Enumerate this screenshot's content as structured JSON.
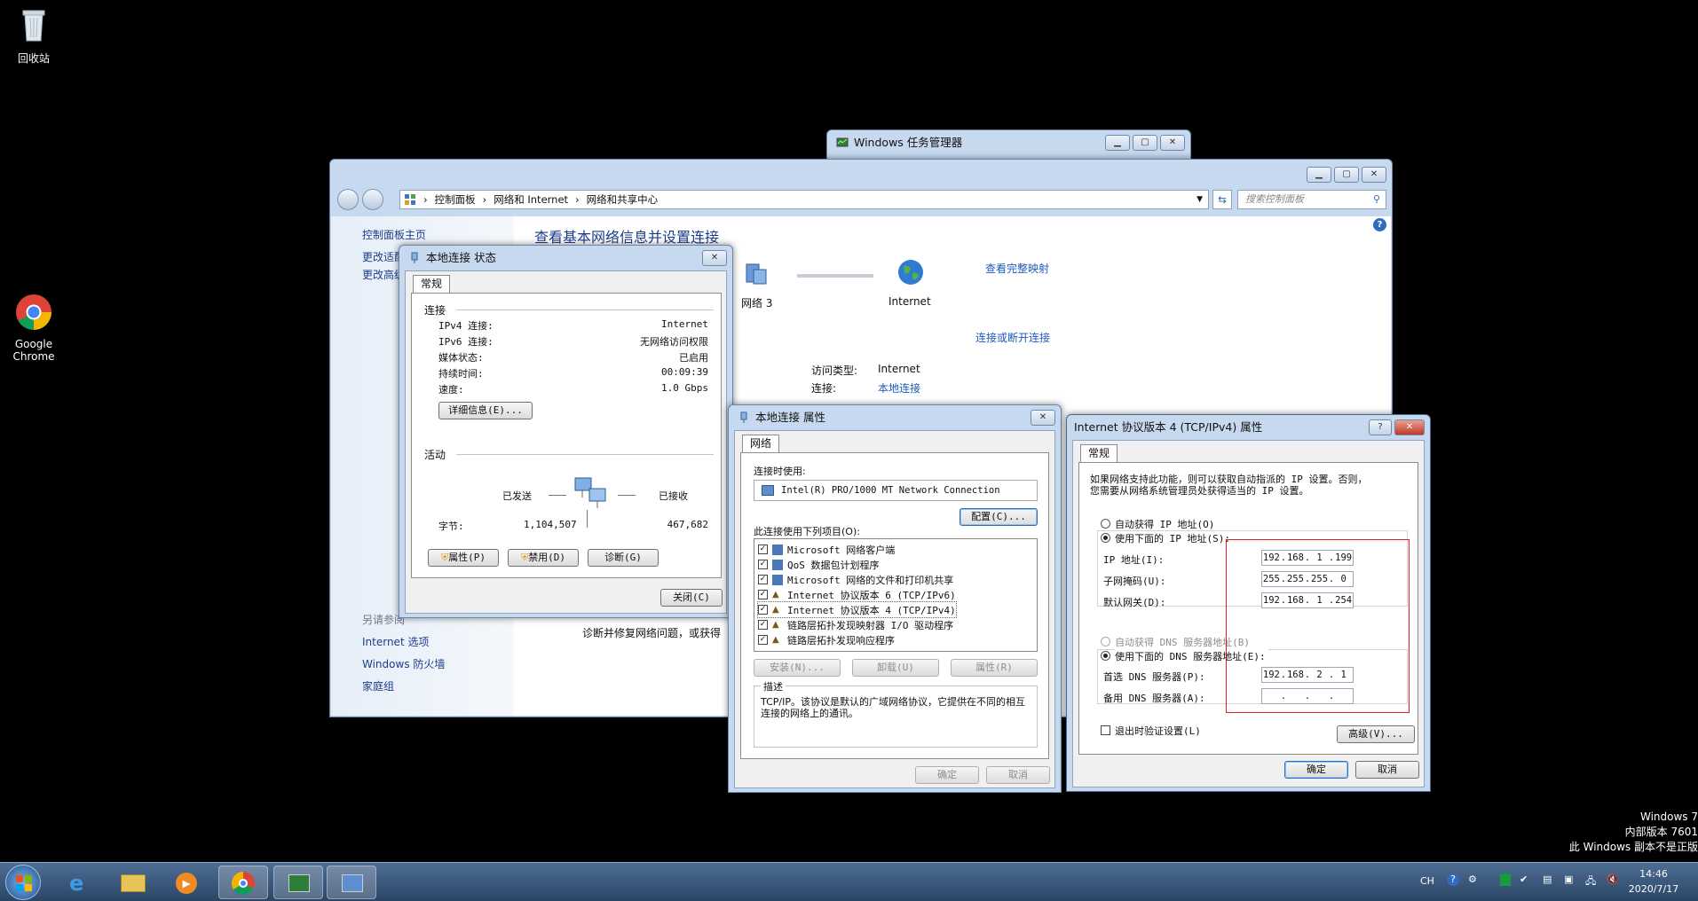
{
  "desktop": {
    "recycle_bin": "回收站",
    "chrome_line1": "Google",
    "chrome_line2": "Chrome",
    "watermark": [
      "Windows 7",
      "内部版本 7601",
      "此 Windows 副本不是正版"
    ]
  },
  "task_manager": {
    "title": "Windows 任务管理器"
  },
  "control_panel": {
    "breadcrumb": [
      "控制面板",
      "网络和 Internet",
      "网络和共享中心"
    ],
    "search_placeholder": "搜索控制面板",
    "sidebar": {
      "home": "控制面板主页",
      "item1": "更改适配",
      "item2": "更改高级",
      "see_also": "另请参阅",
      "links": [
        "Internet 选项",
        "Windows 防火墙",
        "家庭组"
      ]
    },
    "heading": "查看基本网络信息并设置连接",
    "network_name": "网络 3",
    "internet_label": "Internet",
    "view_full_map": "查看完整映射",
    "connect_disconnect": "连接或断开连接",
    "access_type_label": "访问类型:",
    "access_type_value": "Internet",
    "connection_label": "连接:",
    "connection_value": "本地连接",
    "troubleshoot": "诊断并修复网络问题，或获得"
  },
  "status_dialog": {
    "title": "本地连接 状态",
    "tab": "常规",
    "section_connection": "连接",
    "rows": [
      {
        "label": "IPv4 连接:",
        "value": "Internet"
      },
      {
        "label": "IPv6 连接:",
        "value": "无网络访问权限"
      },
      {
        "label": "媒体状态:",
        "value": "已启用"
      },
      {
        "label": "持续时间:",
        "value": "00:09:39"
      },
      {
        "label": "速度:",
        "value": "1.0 Gbps"
      }
    ],
    "details_button": "详细信息(E)...",
    "section_activity": "活动",
    "sent_label": "已发送",
    "received_label": "已接收",
    "bytes_label": "字节:",
    "bytes_sent": "1,104,507",
    "bytes_received": "467,682",
    "properties_button": "属性(P)",
    "disable_button": "禁用(D)",
    "diagnose_button": "诊断(G)",
    "close_button": "关闭(C)"
  },
  "props_dialog": {
    "title": "本地连接 属性",
    "tab": "网络",
    "connect_using_label": "连接时使用:",
    "adapter": "Intel(R) PRO/1000 MT Network Connection",
    "configure_button": "配置(C)...",
    "items_label": "此连接使用下列项目(O):",
    "items": [
      "Microsoft 网络客户端",
      "QoS 数据包计划程序",
      "Microsoft 网络的文件和打印机共享",
      "Internet 协议版本 6 (TCP/IPv6)",
      "Internet 协议版本 4 (TCP/IPv4)",
      "链路层拓扑发现映射器 I/O 驱动程序",
      "链路层拓扑发现响应程序"
    ],
    "install_button": "安装(N)...",
    "uninstall_button": "卸载(U)",
    "properties_button": "属性(R)",
    "description_label": "描述",
    "description_text": "TCP/IP。该协议是默认的广域网络协议，它提供在不同的相互连接的网络上的通讯。",
    "ok_button": "确定",
    "cancel_button": "取消"
  },
  "ipv4_dialog": {
    "title": "Internet 协议版本 4 (TCP/IPv4) 属性",
    "help_button": "?",
    "tab": "常规",
    "intro_line1": "如果网络支持此功能，则可以获取自动指派的 IP 设置。否则，",
    "intro_line2": "您需要从网络系统管理员处获得适当的 IP 设置。",
    "auto_ip": "自动获得 IP 地址(O)",
    "manual_ip": "使用下面的 IP 地址(S):",
    "ip_label": "IP 地址(I):",
    "ip_value": [
      "192",
      "168",
      "1",
      "199"
    ],
    "mask_label": "子网掩码(U):",
    "mask_value": [
      "255",
      "255",
      "255",
      "0"
    ],
    "gateway_label": "默认网关(D):",
    "gateway_value": [
      "192",
      "168",
      "1",
      "254"
    ],
    "auto_dns": "自动获得 DNS 服务器地址(B)",
    "manual_dns": "使用下面的 DNS 服务器地址(E):",
    "pref_dns_label": "首选 DNS 服务器(P):",
    "pref_dns_value": [
      "192",
      "168",
      "2",
      "1"
    ],
    "alt_dns_label": "备用 DNS 服务器(A):",
    "validate_label": "退出时验证设置(L)",
    "advanced_button": "高级(V)...",
    "ok_button": "确定",
    "cancel_button": "取消"
  },
  "taskbar": {
    "lang": "CH",
    "time": "14:46",
    "date": "2020/7/17"
  }
}
